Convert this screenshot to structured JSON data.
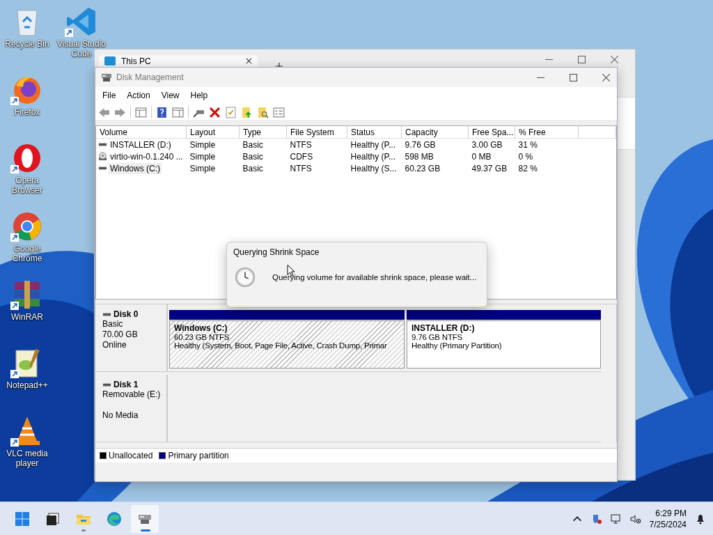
{
  "desktop_icons": [
    {
      "kind": "recycle",
      "label": "Recycle Bin"
    },
    {
      "kind": "vscode",
      "label": "Visual Studio Code"
    },
    {
      "kind": "firefox",
      "label": "Firefox"
    },
    {
      "kind": "opera",
      "label": "Opera Browser"
    },
    {
      "kind": "chrome",
      "label": "Google Chrome"
    },
    {
      "kind": "winrar",
      "label": "WinRAR"
    },
    {
      "kind": "notepad",
      "label": "Notepad++"
    },
    {
      "kind": "vlc",
      "label": "VLC media player"
    }
  ],
  "back_window": {
    "tab": {
      "title": "This PC"
    }
  },
  "window": {
    "title": "Disk Management",
    "menu": [
      "File",
      "Action",
      "View",
      "Help"
    ],
    "table": {
      "columns": [
        "Volume",
        "Layout",
        "Type",
        "File System",
        "Status",
        "Capacity",
        "Free Spa...",
        "% Free"
      ],
      "rows": [
        {
          "kind": "disk",
          "selected": false,
          "cells": [
            "INSTALLER (D:)",
            "Simple",
            "Basic",
            "NTFS",
            "Healthy (P...",
            "9.76 GB",
            "3.00 GB",
            "31 %"
          ]
        },
        {
          "kind": "cd",
          "selected": false,
          "cells": [
            "virtio-win-0.1.240 ...",
            "Simple",
            "Basic",
            "CDFS",
            "Healthy (P...",
            "598 MB",
            "0 MB",
            "0 %"
          ]
        },
        {
          "kind": "disk",
          "selected": true,
          "cells": [
            "Windows (C:)",
            "Simple",
            "Basic",
            "NTFS",
            "Healthy (S...",
            "60.23 GB",
            "49.37 GB",
            "82 %"
          ]
        }
      ]
    },
    "disks": [
      {
        "name": "Disk 0",
        "type": "Basic",
        "size": "70.00 GB",
        "state": "Online",
        "partitions": [
          {
            "name": "Windows  (C:)",
            "size": "60.23 GB NTFS",
            "status": "Healthy (System, Boot, Page File, Active, Crash Dump, Primar",
            "selected": true
          },
          {
            "name": "INSTALLER  (D:)",
            "size": "9.76 GB NTFS",
            "status": "Healthy (Primary Partition)",
            "selected": false
          }
        ]
      },
      {
        "name": "Disk 1",
        "type": "Removable (E:)",
        "state": "No Media"
      }
    ],
    "legend": [
      {
        "label": "Unallocated",
        "color": "#000000"
      },
      {
        "label": "Primary partition",
        "color": "#000080"
      }
    ]
  },
  "dialog": {
    "title": "Querying Shrink Space",
    "message": "Querying volume for available shrink space, please wait..."
  },
  "taskbar": {
    "items": [
      {
        "kind": "start",
        "selected": false,
        "running": false
      },
      {
        "kind": "taskview",
        "selected": false,
        "running": false
      },
      {
        "kind": "explorer",
        "selected": false,
        "running": true
      },
      {
        "kind": "edge",
        "selected": false,
        "running": false
      },
      {
        "kind": "diskmgmt",
        "selected": true,
        "running": true
      }
    ],
    "time": "6:29 PM",
    "date": "7/25/2024"
  }
}
